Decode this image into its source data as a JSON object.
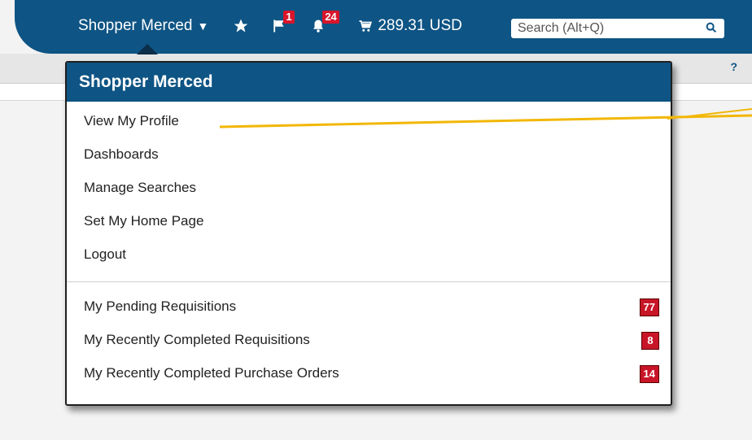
{
  "topbar": {
    "user_name": "Shopper Merced",
    "flag_count": "1",
    "notification_count": "24",
    "cart_total": "289.31 USD",
    "search_placeholder": "Search (Alt+Q)",
    "help_label": "?"
  },
  "dropdown": {
    "title": "Shopper Merced",
    "items": [
      {
        "label": "View My Profile"
      },
      {
        "label": "Dashboards"
      },
      {
        "label": "Manage Searches"
      },
      {
        "label": "Set My Home Page"
      },
      {
        "label": "Logout"
      }
    ],
    "requisitions": [
      {
        "label": "My Pending Requisitions",
        "count": "77"
      },
      {
        "label": "My Recently Completed Requisitions",
        "count": "8"
      },
      {
        "label": "My Recently Completed Purchase Orders",
        "count": "14"
      }
    ]
  },
  "colors": {
    "navy": "#0e5484",
    "badge_red": "#c81528",
    "annotation": "#f2b705"
  }
}
